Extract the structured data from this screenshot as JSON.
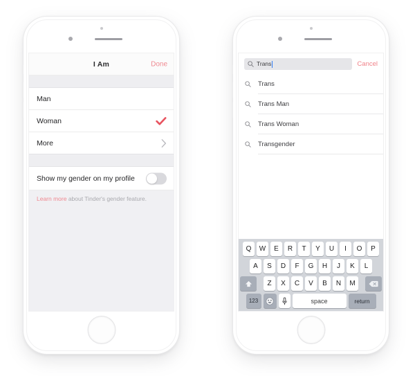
{
  "page": {
    "background": "#ffffff",
    "accent_pink": "#ef8890",
    "checkmark_red": "#e8535f",
    "caret_blue": "#2f7cf6"
  },
  "left_phone": {
    "name": "iphone-gender-settings",
    "nav": {
      "title": "I Am",
      "done_label": "Done"
    },
    "options": [
      {
        "label": "Man",
        "accessory": "none"
      },
      {
        "label": "Woman",
        "accessory": "checkmark"
      },
      {
        "label": "More",
        "accessory": "chevron"
      }
    ],
    "toggle_row": {
      "label": "Show my gender on my profile",
      "state": "off"
    },
    "footer": {
      "link_text": "Learn more",
      "rest_text": " about Tinder's gender feature."
    }
  },
  "right_phone": {
    "name": "iphone-gender-search",
    "search": {
      "icon": "search-icon",
      "value": "Trans",
      "placeholder": "Search",
      "cancel_label": "Cancel"
    },
    "results": [
      {
        "label": "Trans",
        "icon": "search-icon"
      },
      {
        "label": "Trans Man",
        "icon": "search-icon"
      },
      {
        "label": "Trans Woman",
        "icon": "search-icon"
      },
      {
        "label": "Transgender",
        "icon": "search-icon"
      }
    ],
    "keyboard": {
      "row1": [
        "Q",
        "W",
        "E",
        "R",
        "T",
        "Y",
        "U",
        "I",
        "O",
        "P"
      ],
      "row2": [
        "A",
        "S",
        "D",
        "F",
        "G",
        "H",
        "J",
        "K",
        "L"
      ],
      "row3": [
        "Z",
        "X",
        "C",
        "V",
        "B",
        "N",
        "M"
      ],
      "shift_icon": "shift-arrow-icon",
      "backspace_icon": "backspace-icon",
      "numbers_label": "123",
      "emoji_icon": "emoji-smiley-icon",
      "mic_icon": "microphone-icon",
      "space_label": "space",
      "return_label": "return"
    }
  }
}
